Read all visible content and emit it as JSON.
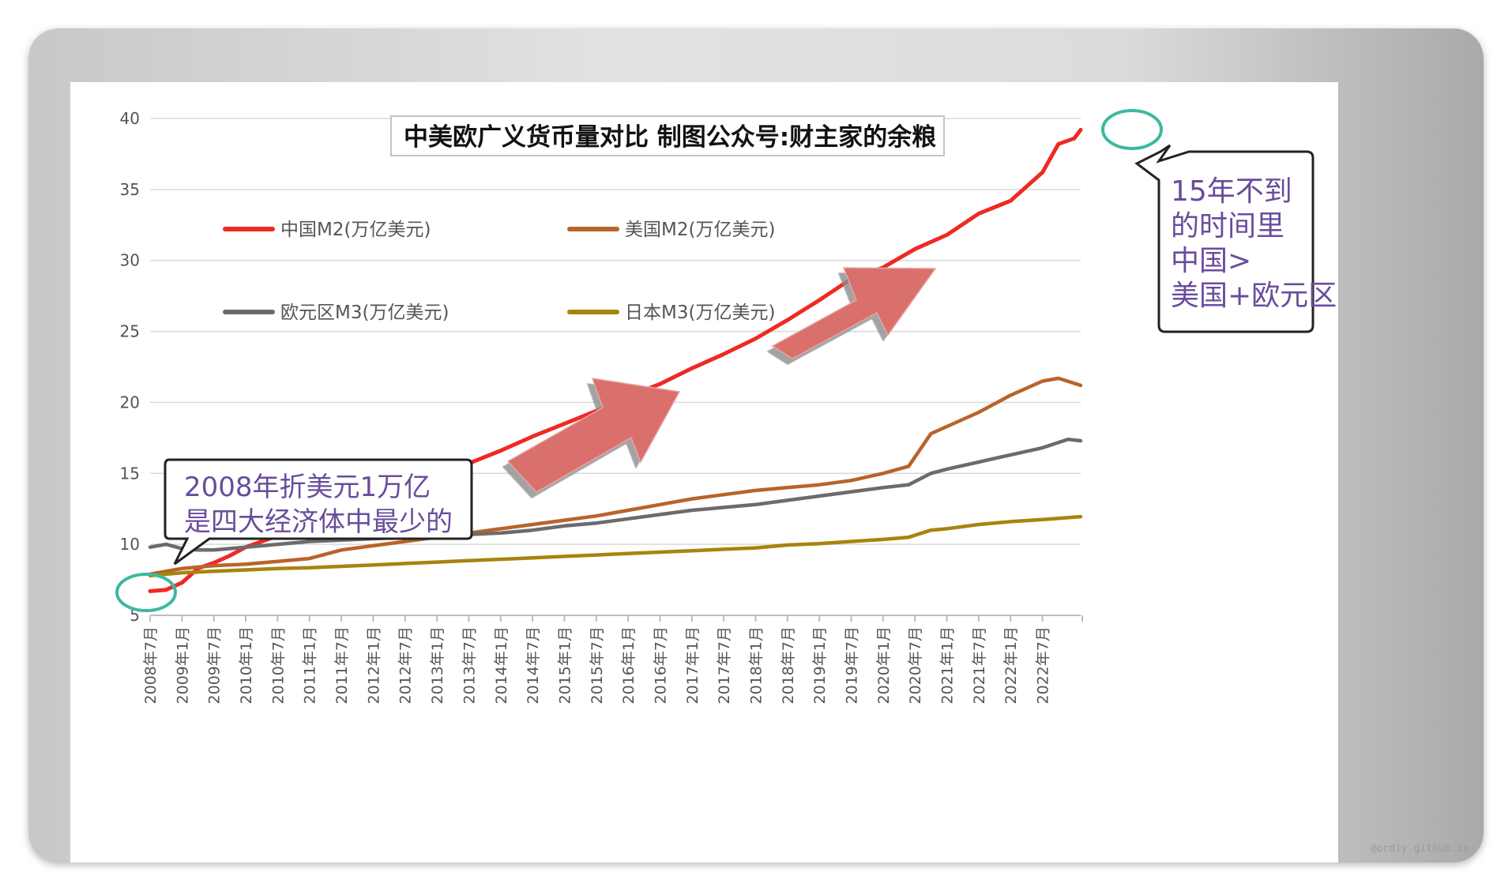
{
  "watermark": "@ordiy.github.io",
  "chart_data": {
    "type": "line",
    "title": "中美欧广义货币量对比 制图公众号:财主家的余粮",
    "ylim": [
      5,
      40
    ],
    "yticks": [
      5,
      10,
      15,
      20,
      25,
      30,
      35,
      40
    ],
    "grid": true,
    "legend_position": "top-left",
    "x_tick_labels": [
      "2008年7月",
      "2009年1月",
      "2009年7月",
      "2010年1月",
      "2010年7月",
      "2011年1月",
      "2011年7月",
      "2012年1月",
      "2012年7月",
      "2013年1月",
      "2013年7月",
      "2014年1月",
      "2014年7月",
      "2015年1月",
      "2015年7月",
      "2016年1月",
      "2016年7月",
      "2017年1月",
      "2017年7月",
      "2018年1月",
      "2018年7月",
      "2019年1月",
      "2019年7月",
      "2020年1月",
      "2020年7月",
      "2021年1月",
      "2021年7月",
      "2022年1月",
      "2022年7月"
    ],
    "x_index_range": [
      0,
      29.2
    ],
    "series": [
      {
        "name": "中国M2(万亿美元)",
        "color": "#ee2a24",
        "points": [
          [
            0,
            6.7
          ],
          [
            0.5,
            6.8
          ],
          [
            1,
            7.3
          ],
          [
            1.5,
            8.3
          ],
          [
            2,
            8.7
          ],
          [
            2.5,
            9.2
          ],
          [
            3,
            9.8
          ],
          [
            3.5,
            10.2
          ],
          [
            4,
            10.6
          ],
          [
            5,
            11.4
          ],
          [
            6,
            12.4
          ],
          [
            7,
            13.0
          ],
          [
            8,
            14.0
          ],
          [
            9,
            14.6
          ],
          [
            10,
            15.7
          ],
          [
            11,
            16.6
          ],
          [
            12,
            17.6
          ],
          [
            13,
            18.5
          ],
          [
            14,
            19.4
          ],
          [
            15,
            20.4
          ],
          [
            16,
            21.3
          ],
          [
            17,
            22.4
          ],
          [
            18,
            23.4
          ],
          [
            19,
            24.5
          ],
          [
            20,
            25.8
          ],
          [
            21,
            27.2
          ],
          [
            22,
            28.7
          ],
          [
            23,
            29.5
          ],
          [
            24,
            30.8
          ],
          [
            25,
            31.8
          ],
          [
            26,
            33.3
          ],
          [
            27,
            34.2
          ],
          [
            28,
            36.2
          ],
          [
            28.5,
            38.2
          ],
          [
            29,
            38.6
          ],
          [
            29.2,
            39.2
          ]
        ]
      },
      {
        "name": "美国M2(万亿美元)",
        "color": "#b9632a",
        "points": [
          [
            0,
            7.9
          ],
          [
            1,
            8.3
          ],
          [
            2,
            8.5
          ],
          [
            3,
            8.6
          ],
          [
            4,
            8.8
          ],
          [
            5,
            9.0
          ],
          [
            6,
            9.6
          ],
          [
            7,
            9.9
          ],
          [
            8,
            10.2
          ],
          [
            9,
            10.5
          ],
          [
            10,
            10.8
          ],
          [
            11,
            11.1
          ],
          [
            12,
            11.4
          ],
          [
            13,
            11.7
          ],
          [
            14,
            12.0
          ],
          [
            15,
            12.4
          ],
          [
            16,
            12.8
          ],
          [
            17,
            13.2
          ],
          [
            18,
            13.5
          ],
          [
            19,
            13.8
          ],
          [
            20,
            14.0
          ],
          [
            21,
            14.2
          ],
          [
            22,
            14.5
          ],
          [
            23,
            15.0
          ],
          [
            23.8,
            15.5
          ],
          [
            24.5,
            17.8
          ],
          [
            25,
            18.3
          ],
          [
            26,
            19.3
          ],
          [
            27,
            20.5
          ],
          [
            28,
            21.5
          ],
          [
            28.5,
            21.7
          ],
          [
            29.2,
            21.2
          ]
        ]
      },
      {
        "name": "欧元区M3(万亿美元)",
        "color": "#6b6b6b",
        "points": [
          [
            0,
            9.8
          ],
          [
            0.5,
            10.0
          ],
          [
            1,
            9.7
          ],
          [
            1.5,
            9.6
          ],
          [
            2,
            9.6
          ],
          [
            3,
            9.8
          ],
          [
            4,
            10.0
          ],
          [
            5,
            10.2
          ],
          [
            6,
            10.3
          ],
          [
            7,
            10.4
          ],
          [
            8,
            10.5
          ],
          [
            9,
            10.6
          ],
          [
            10,
            10.7
          ],
          [
            11,
            10.8
          ],
          [
            12,
            11.0
          ],
          [
            13,
            11.3
          ],
          [
            14,
            11.5
          ],
          [
            15,
            11.8
          ],
          [
            16,
            12.1
          ],
          [
            17,
            12.4
          ],
          [
            18,
            12.6
          ],
          [
            19,
            12.8
          ],
          [
            20,
            13.1
          ],
          [
            21,
            13.4
          ],
          [
            22,
            13.7
          ],
          [
            23,
            14.0
          ],
          [
            23.8,
            14.2
          ],
          [
            24.5,
            15.0
          ],
          [
            25,
            15.3
          ],
          [
            26,
            15.8
          ],
          [
            27,
            16.3
          ],
          [
            28,
            16.8
          ],
          [
            28.8,
            17.4
          ],
          [
            29.2,
            17.3
          ]
        ]
      },
      {
        "name": "日本M3(万亿美元)",
        "color": "#a6850e",
        "points": [
          [
            0,
            7.8
          ],
          [
            1,
            8.0
          ],
          [
            2,
            8.1
          ],
          [
            3,
            8.2
          ],
          [
            4,
            8.3
          ],
          [
            5,
            8.35
          ],
          [
            6,
            8.45
          ],
          [
            7,
            8.55
          ],
          [
            8,
            8.65
          ],
          [
            9,
            8.75
          ],
          [
            10,
            8.85
          ],
          [
            11,
            8.95
          ],
          [
            12,
            9.05
          ],
          [
            13,
            9.15
          ],
          [
            14,
            9.25
          ],
          [
            15,
            9.35
          ],
          [
            16,
            9.45
          ],
          [
            17,
            9.55
          ],
          [
            18,
            9.65
          ],
          [
            19,
            9.75
          ],
          [
            20,
            9.95
          ],
          [
            21,
            10.05
          ],
          [
            22,
            10.2
          ],
          [
            23,
            10.35
          ],
          [
            23.8,
            10.5
          ],
          [
            24.5,
            11.0
          ],
          [
            25,
            11.1
          ],
          [
            26,
            11.4
          ],
          [
            27,
            11.6
          ],
          [
            28,
            11.75
          ],
          [
            29.2,
            11.95
          ]
        ]
      }
    ],
    "annotations": {
      "callout_2008": [
        "2008年折美元1万亿",
        "是四大经济体中最少的"
      ],
      "callout_china": [
        "15年不到",
        "的时间里",
        "中国>",
        "美国+欧元区"
      ]
    }
  }
}
